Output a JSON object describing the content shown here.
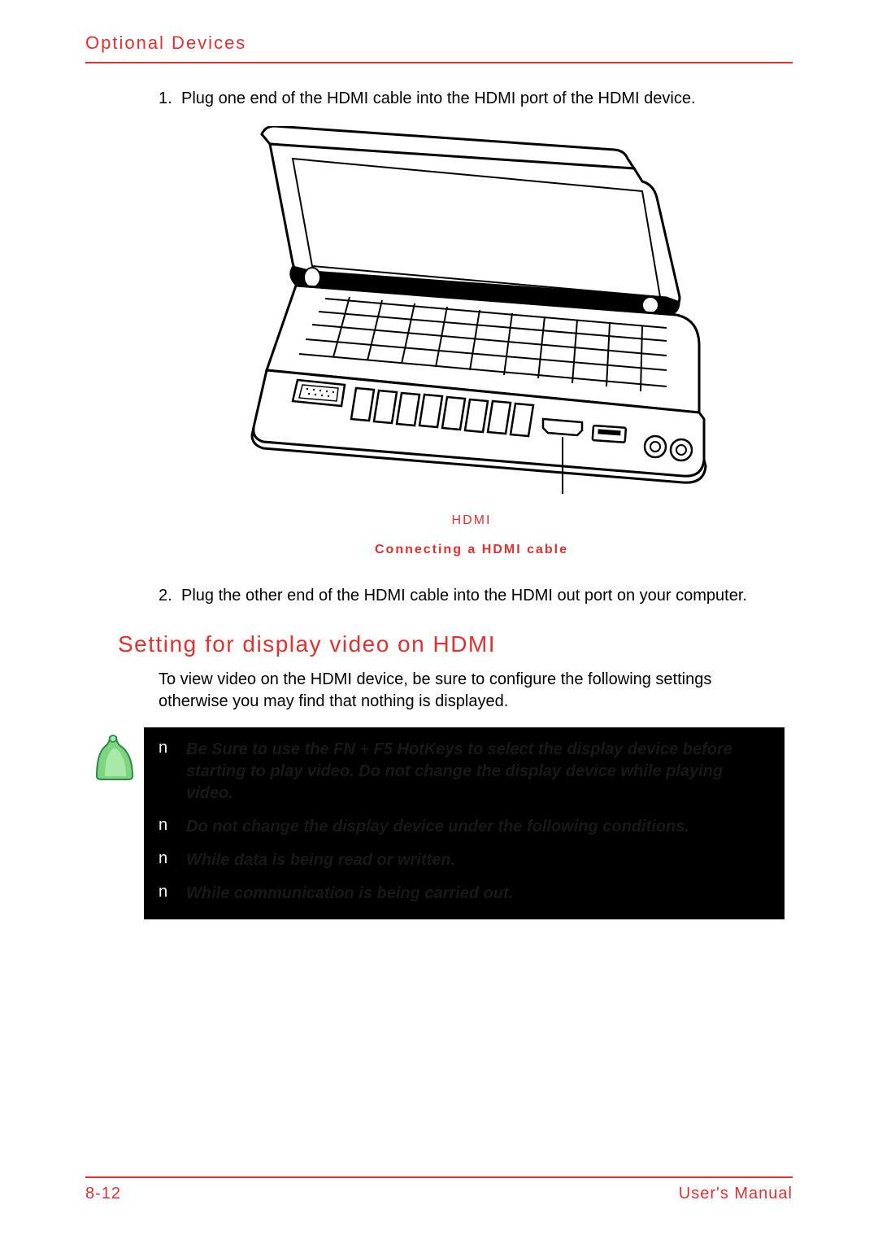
{
  "header": {
    "title": "Optional Devices"
  },
  "steps": {
    "s1": {
      "num": "1.",
      "text": "Plug one end of the HDMI cable into the HDMI port of the HDMI device."
    },
    "s2": {
      "num": "2.",
      "text": "Plug the other end of the HDMI cable into the HDMI out port on your computer."
    }
  },
  "figure": {
    "hdmi_label": "HDMI",
    "caption": "Connecting a HDMI cable"
  },
  "section": {
    "heading": "Setting for display video on HDMI",
    "intro": "To view video on the HDMI device, be sure to configure the following settings otherwise you may find that nothing is displayed."
  },
  "notes": {
    "bullet": "n",
    "items": [
      "Be Sure to use the FN + F5 HotKeys to select the display device before starting to play video. Do not change the display device while playing video.",
      "Do not change the display device under the following conditions.",
      "While data is being read or written.",
      "While communication is being carried out."
    ]
  },
  "footer": {
    "page": "8-12",
    "doc": "User's Manual"
  }
}
